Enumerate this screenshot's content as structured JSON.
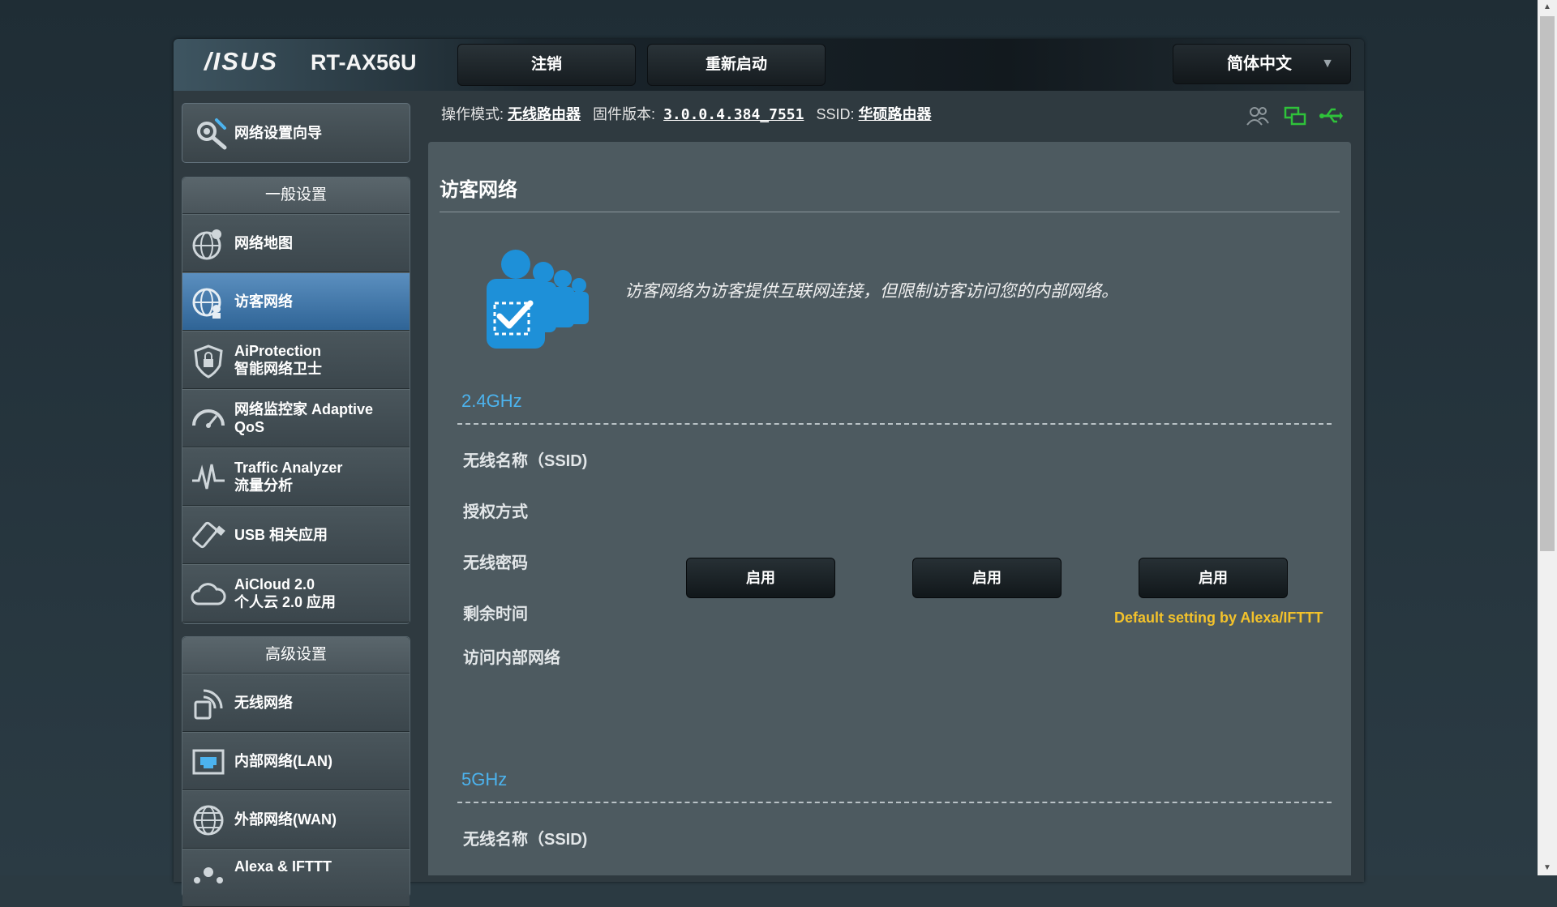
{
  "header": {
    "logo": "/ISUS",
    "model": "RT-AX56U",
    "logout_label": "注销",
    "reboot_label": "重新启动",
    "language": "简体中文"
  },
  "status": {
    "mode_label": "操作模式:",
    "mode_value": "无线路由器",
    "firmware_label": "固件版本:",
    "firmware_value": "3.0.0.4.384_7551",
    "ssid_label": "SSID:",
    "ssid_value": "华硕路由器"
  },
  "sidebar": {
    "wizard": "网络设置向导",
    "general_heading": "一般设置",
    "general_items": [
      {
        "label": "网络地图"
      },
      {
        "label": "访客网络"
      },
      {
        "label": "AiProtection\n智能网络卫士"
      },
      {
        "label": "网络监控家 Adaptive QoS"
      },
      {
        "label": "Traffic Analyzer\n流量分析"
      },
      {
        "label": "USB 相关应用"
      },
      {
        "label": "AiCloud 2.0\n个人云 2.0 应用"
      }
    ],
    "advanced_heading": "高级设置",
    "advanced_items": [
      {
        "label": "无线网络"
      },
      {
        "label": "内部网络(LAN)"
      },
      {
        "label": "外部网络(WAN)"
      },
      {
        "label": "Alexa & IFTTT"
      }
    ]
  },
  "main": {
    "title": "访客网络",
    "description": "访客网络为访客提供互联网连接，但限制访客访问您的内部网络。",
    "band_24": {
      "label": "2.4GHz",
      "rows": [
        "无线名称（SSID)",
        "授权方式",
        "无线密码",
        "剩余时间",
        "访问内部网络"
      ],
      "buttons": [
        "启用",
        "启用",
        "启用"
      ],
      "note": "Default setting by Alexa/IFTTT"
    },
    "band_5": {
      "label": "5GHz",
      "rows": [
        "无线名称（SSID)"
      ]
    }
  },
  "colors": {
    "accent_blue": "#4cb3ee",
    "note_yellow": "#f3c22b",
    "active_item": "#3f77ad"
  }
}
